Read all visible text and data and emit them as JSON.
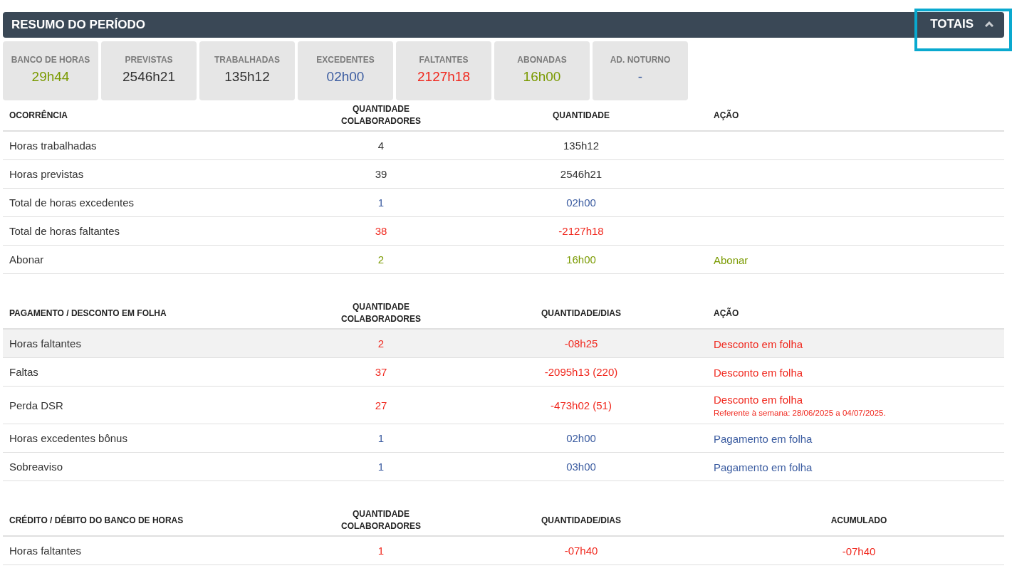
{
  "header": {
    "title": "RESUMO DO PERÍODO",
    "toggle": {
      "label": "TOTAIS",
      "expanded": true,
      "focused": true
    }
  },
  "cards": [
    {
      "label": "BANCO DE HORAS",
      "value": "29h44",
      "color": "#7a9a01"
    },
    {
      "label": "PREVISTAS",
      "value": "2546h21",
      "color": "#333333"
    },
    {
      "label": "TRABALHADAS",
      "value": "135h12",
      "color": "#333333"
    },
    {
      "label": "EXCEDENTES",
      "value": "02h00",
      "color": "#3a5ba0"
    },
    {
      "label": "FALTANTES",
      "value": "2127h18",
      "color": "#f0281e"
    },
    {
      "label": "ABONADAS",
      "value": "16h00",
      "color": "#7a9a01"
    },
    {
      "label": "AD. NOTURNO",
      "value": "-",
      "color": "#3a5ba0"
    }
  ],
  "tables": [
    {
      "columns": [
        "OCORRÊNCIA",
        "QUANTIDADE COLABORADORES",
        "QUANTIDADE",
        "AÇÃO"
      ],
      "kind": "action",
      "rows": [
        {
          "name": "Horas trabalhadas",
          "count": "4",
          "quantity": "135h12",
          "color": "#333333",
          "selected": false
        },
        {
          "name": "Horas previstas",
          "count": "39",
          "quantity": "2546h21",
          "color": "#333333",
          "selected": false
        },
        {
          "name": "Total de horas excedentes",
          "count": "1",
          "quantity": "02h00",
          "color": "#3a5ba0",
          "selected": false
        },
        {
          "name": "Total de horas faltantes",
          "count": "38",
          "quantity": "-2127h18",
          "color": "#f0281e",
          "selected": false
        },
        {
          "name": "Abonar",
          "count": "2",
          "quantity": "16h00",
          "action": "Abonar",
          "color": "#7a9a01",
          "selected": false
        }
      ]
    },
    {
      "columns": [
        "PAGAMENTO / DESCONTO EM FOLHA",
        "QUANTIDADE COLABORADORES",
        "QUANTIDADE/DIAS",
        "AÇÃO"
      ],
      "kind": "action",
      "rows": [
        {
          "name": "Horas faltantes",
          "count": "2",
          "quantity": "-08h25",
          "action": "Desconto em folha",
          "color": "#f0281e",
          "selected": true
        },
        {
          "name": "Faltas",
          "count": "37",
          "quantity": "-2095h13 (220)",
          "action": "Desconto em folha",
          "color": "#f0281e",
          "selected": false
        },
        {
          "name": "Perda DSR",
          "count": "27",
          "quantity": "-473h02 (51)",
          "action": "Desconto em folha",
          "note": "Referente à semana: 28/06/2025 a 04/07/2025.",
          "color": "#f0281e",
          "selected": false
        },
        {
          "name": "Horas excedentes bônus",
          "count": "1",
          "quantity": "02h00",
          "action": "Pagamento em folha",
          "color": "#3a5ba0",
          "selected": false
        },
        {
          "name": "Sobreaviso",
          "count": "1",
          "quantity": "03h00",
          "action": "Pagamento em folha",
          "color": "#3a5ba0",
          "selected": false
        }
      ]
    },
    {
      "columns": [
        "CRÉDITO / DÉBITO DO BANCO DE HORAS",
        "QUANTIDADE COLABORADORES",
        "QUANTIDADE/DIAS",
        "ACUMULADO"
      ],
      "kind": "balance",
      "rows": [
        {
          "name": "Horas faltantes",
          "count": "1",
          "quantity": "-07h40",
          "accumulated": "-07h40",
          "color": "#f0281e",
          "selected": false
        }
      ]
    }
  ]
}
